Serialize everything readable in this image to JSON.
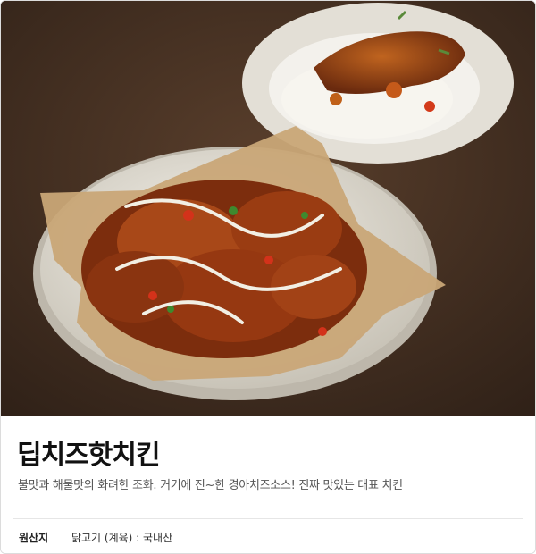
{
  "product": {
    "image_alt": "딥치즈핫치킨 메뉴 사진",
    "name": "딥치즈핫치킨",
    "description": "불맛과 해물맛의 화려한 조화. 거기에 진~한 경아치즈소스! 진짜 맛있는 대표 치킨",
    "origin_label": "원산지",
    "origin_value": "닭고기 (계육) : 국내산"
  },
  "colors": {
    "background_table": "#4a3324",
    "sauce": "#8a3a14",
    "cheese": "#f2efe4"
  }
}
